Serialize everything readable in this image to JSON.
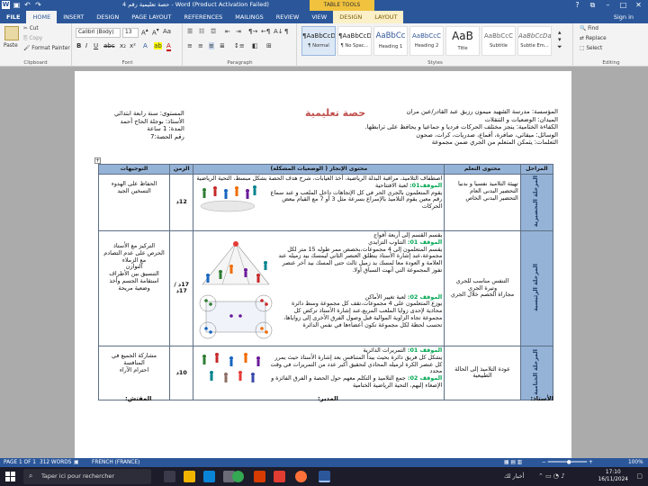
{
  "window": {
    "title": "حصة تعليمية رقم 4 - Word (Product Activation Failed)",
    "context_tab_group": "TABLE TOOLS",
    "sign_in": "Sign in"
  },
  "tabs": [
    "FILE",
    "HOME",
    "INSERT",
    "DESIGN",
    "PAGE LAYOUT",
    "REFERENCES",
    "MAILINGS",
    "REVIEW",
    "VIEW",
    "DESIGN",
    "LAYOUT"
  ],
  "ribbon": {
    "clipboard": {
      "paste": "Paste",
      "cut": "Cut",
      "copy": "Copy",
      "format_painter": "Format Painter",
      "label": "Clipboard"
    },
    "font": {
      "name": "Calibri (Body)",
      "size": "13",
      "label": "Font"
    },
    "paragraph": {
      "label": "Paragraph"
    },
    "styles": {
      "label": "Styles",
      "items": [
        {
          "sample": "¶AaBbCcDc",
          "name": "¶ Normal"
        },
        {
          "sample": "¶AaBbCcDc",
          "name": "¶ No Spac..."
        },
        {
          "sample": "AaBbCc",
          "name": "Heading 1"
        },
        {
          "sample": "AaBbCcC",
          "name": "Heading 2"
        },
        {
          "sample": "AaB",
          "name": "Title"
        },
        {
          "sample": "AaBbCcC",
          "name": "Subtitle"
        },
        {
          "sample": "AaBbCcDa",
          "name": "Subtle Em..."
        }
      ]
    },
    "editing": {
      "find": "Find",
      "replace": "Replace",
      "select": "Select",
      "label": "Editing"
    }
  },
  "doc": {
    "title": "حصة تعليمية",
    "header_right": [
      "المؤسسة: مدرسة الشهيد ميمون رزيق عبد القادر/عين مران",
      "الميدان: الوضعيات و التنقلات",
      "الكفاءة الختامية: ينجز مختلف الحركات فرديا و جماعيا و يحافظ على ترابطها.",
      "الوسائل: ميقاتي، صافرة، أقماع، صدريات، كرات، صحون",
      "التعلمات: يتمكن المتعلم من الجري ضمن مجموعة"
    ],
    "header_left": [
      "المستوى: سنة رابعة ابتدائي",
      "الأستاذ: بوجلة الحاج أحمد",
      "المدة: 1 ساعة",
      "رقم الحصة:7"
    ],
    "table": {
      "headers": [
        "المراحل",
        "محتوى التعلم",
        "محتوى الإنجاز ( الوضعيات المشكلة)",
        "الزمن",
        "التوجيهات"
      ],
      "rows": [
        {
          "phase": "المرحلة التحضيرية",
          "learning": "تهيئة التلاميذ نفسيا و بدنيا\nالتحضير البدني العام\nالتحضير البدني الخاص",
          "content_intro": "اصطفاف التلاميذ، مراقبة البذلة الرياضية، أخذ الغيابات، شرح هدف الحصة بشكل مبسط، التحية الرياضية",
          "situations": [
            {
              "label": "الموقف01:",
              "title": " لعبة الافتتاحية",
              "text": "يقوم المتعلمون بالجري الحر في كل الإتجاهات داخل الملعب و عند سماع رقم معين يقوم التلاميذ بالإسراع بسرعة مثل 3 أو 7 مع القيام ببعض الحركات"
            }
          ],
          "time": "12د",
          "guidance": "الحفاظ على الهدوء\nالتسخين الجيد"
        },
        {
          "phase": "المرحلة الرئيسية",
          "learning": "التنفس مناسب للجري\nوتيرة الجري\nمجاراة الخصم خلال الجري",
          "content_intro": "يقسم القسم إلى أربعة أفواج",
          "situations": [
            {
              "label": "الموقف 01:",
              "title": " التناوب التزايدي",
              "text": "يقسم المتعلمون إلى 4 مجموعات،بخصص ممر طوله 15 متر لكل مجموعة،عند إشارة الأستاذ ينطلق العنصر الثاني ليمسك بيد زميله عند العلامة و العودة معا لمسك يد زميل ثالث حتى المسك بيد آخر عنصر تفوز المجموعة التي أنهت السباق أولا."
            },
            {
              "label": "الموقف 02:",
              "title": " لعبة تغيير الأماكن",
              "text": "يوزع المتعلمون على 4 مجموعات،تقف كل مجموعة وسط دائرة محاذية لإحدى زوايا الملعب المربع،عند إشارة الأستاذ تركض كل مجموعة تجاه الزاوية الموالية قبل وصول الفرق الأخرى إلى زواياها، تحسب لحظة لكل مجموعة تكون أعضاءها في نفس الدائرة"
            }
          ],
          "time": "17د / 17د",
          "guidance": "التركيز مع الأستاذ\nالحرص على عدم التصادم مع الزملاء\nالتوازن\nالتنسيق بين الأطراف\nاستقامة الجسم وأخذ وضعية مريحة"
        },
        {
          "phase": "المرحلة الختامية",
          "learning": "عودة التلاميذ إلى الحالة الطبيعية",
          "content_intro": "",
          "situations": [
            {
              "label": "الموقف 01:",
              "title": " التمريرات الدائرية",
              "text": "يشكل كل فريق دائرة بحيث يبدأ المتنافس بعد إشارة الأستاذ حيث يمرر كل عنصر الكرة لزميله المحاذي لتحقيق أكبر عدد من التمريرات في وقت محدد"
            },
            {
              "label": "الموقف 02:",
              "title": " جمع التلاميذ",
              "text": "و التكلم معهم حول الحصة و الفرق الفائزة و الإصغاء إليهم، التحية الرياضية الختامية"
            }
          ],
          "time": "10د",
          "guidance": "مشاركة الجميع في المنافسة\nاحترام الآراء"
        }
      ]
    },
    "signatures": [
      "الأستاذ:",
      "المدير:",
      "المفتش:"
    ]
  },
  "status": {
    "page": "PAGE 1 OF 1",
    "words": "312 WORDS",
    "language": "FRENCH (FRANCE)",
    "zoom": "100%"
  },
  "taskbar": {
    "search_placeholder": "Taper ici pour rechercher",
    "news": "أخبار لك",
    "time": "17:10",
    "date": "16/11/2024"
  }
}
